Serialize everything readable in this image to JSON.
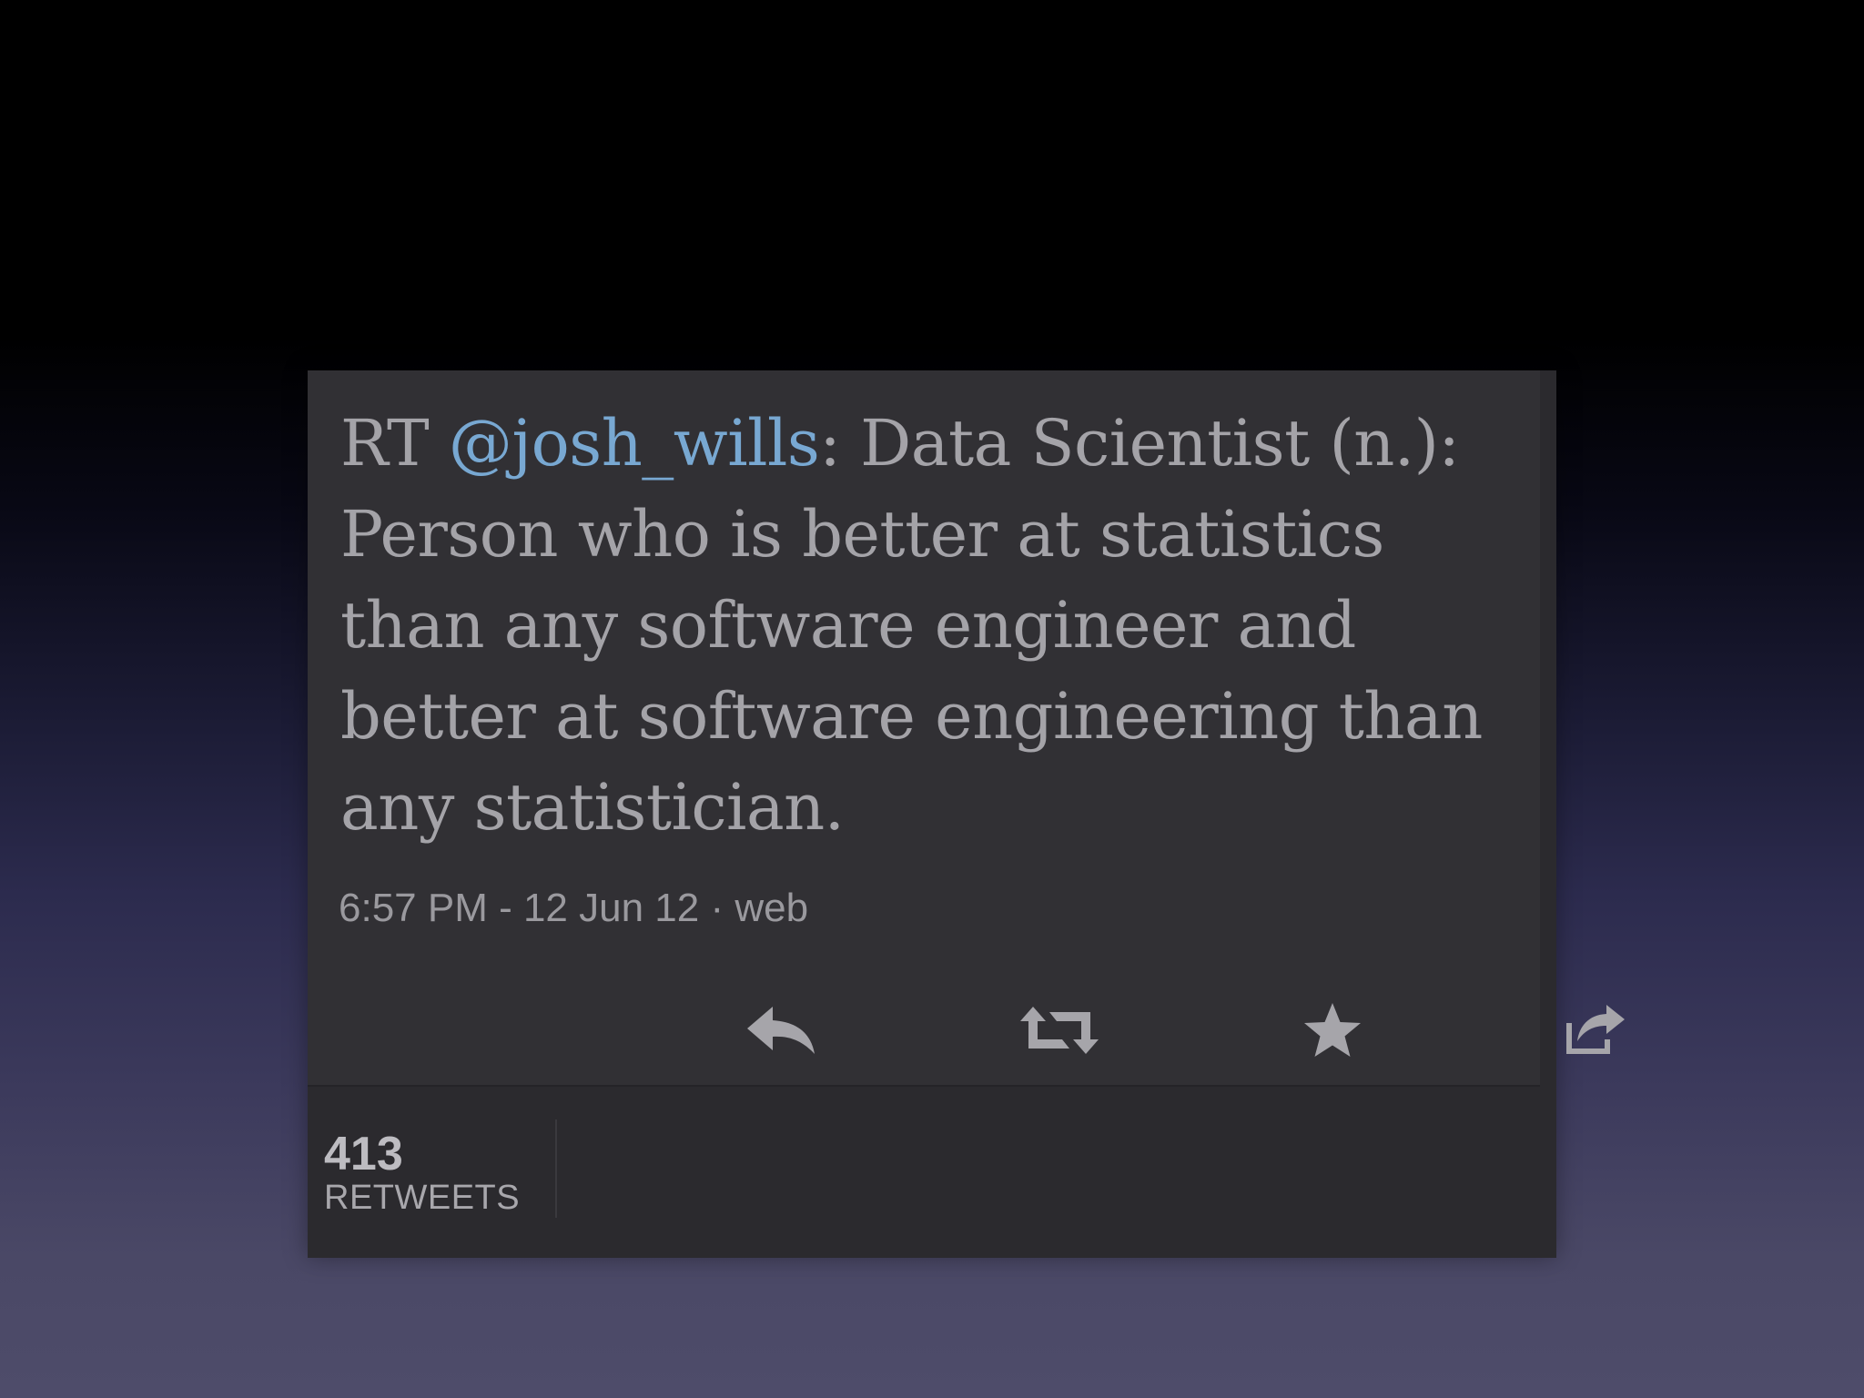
{
  "tweet": {
    "prefix": "RT ",
    "mention": "@josh_wills",
    "body": ": Data Scientist (n.): Person who is better at statistics than any software engineer and better at software engineering than any statistician.",
    "timestamp": "6:57 PM - 12 Jun 12 · web"
  },
  "actions": [
    {
      "name": "reply",
      "icon": "reply-icon"
    },
    {
      "name": "retweet",
      "icon": "retweet-icon"
    },
    {
      "name": "favorite",
      "icon": "star-icon"
    },
    {
      "name": "share",
      "icon": "share-icon"
    }
  ],
  "stats": {
    "retweet_count": "413",
    "retweet_label": "RETWEETS"
  },
  "colors": {
    "card_background": "#313034",
    "footer_background": "#2b2a2e",
    "text": "#a4a3a8",
    "mention": "#78a8d2",
    "icon": "#a6a5aa"
  }
}
